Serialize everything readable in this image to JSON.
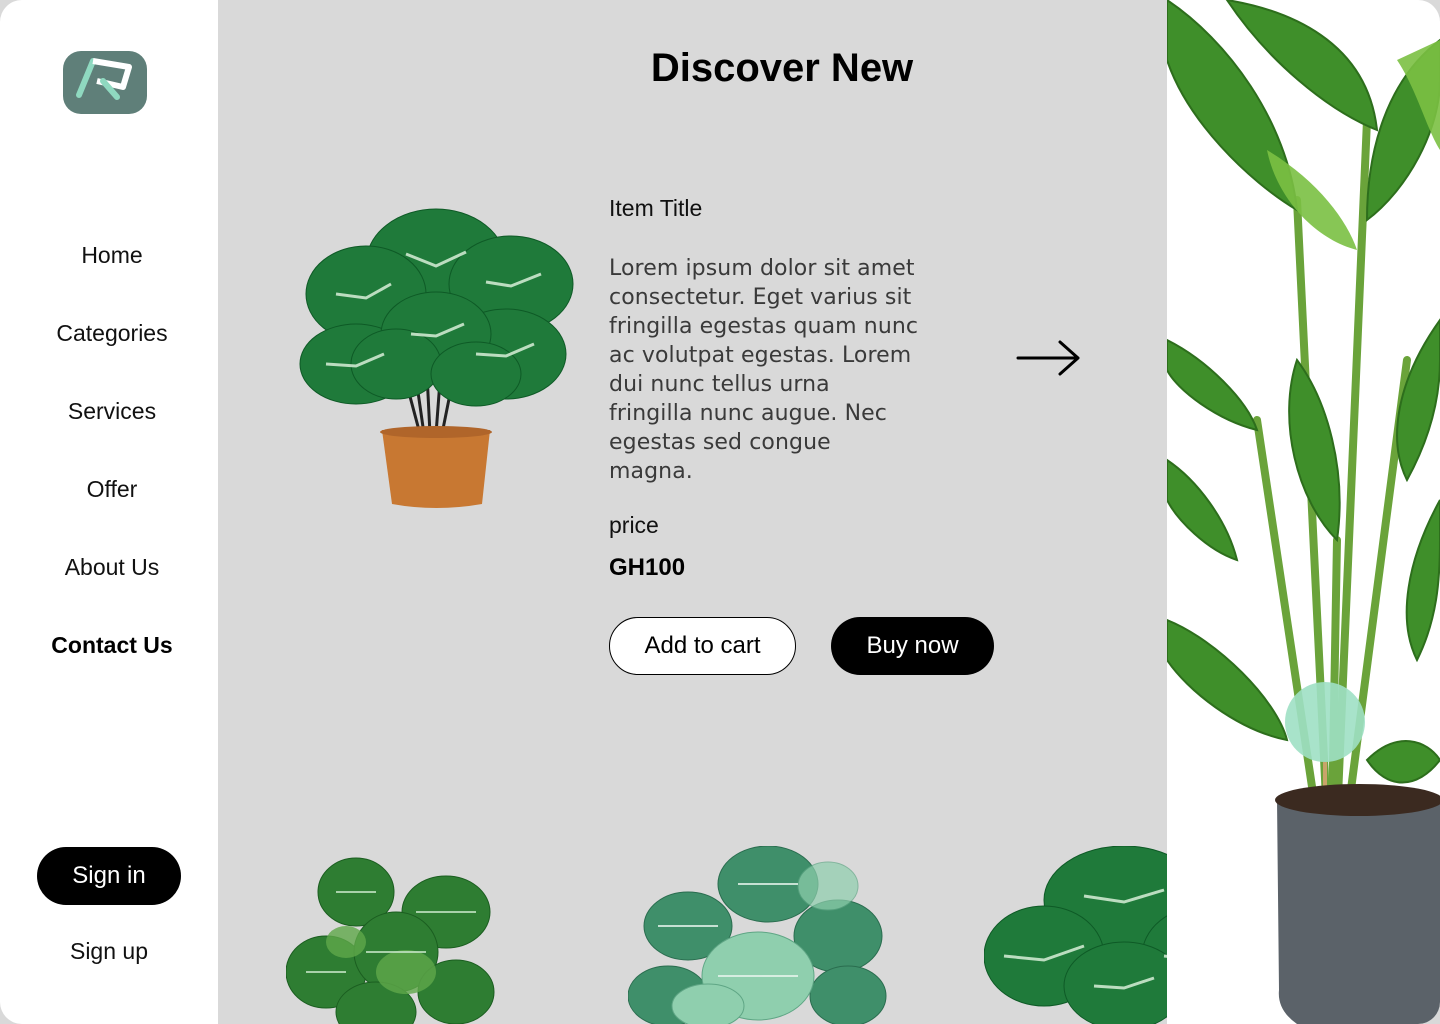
{
  "sidebar": {
    "nav": [
      {
        "label": "Home"
      },
      {
        "label": "Categories"
      },
      {
        "label": "Services"
      },
      {
        "label": "Offer"
      },
      {
        "label": "About Us"
      },
      {
        "label": "Contact Us",
        "active": true
      }
    ],
    "signin_label": "Sign in",
    "signup_label": "Sign up"
  },
  "main": {
    "title": "Discover New",
    "item": {
      "title": "Item Title",
      "description": "Lorem ipsum dolor sit amet consectetur. Eget varius sit fringilla egestas quam nunc ac volutpat egestas. Lorem dui nunc tellus urna fringilla nunc augue. Nec egestas sed congue magna.",
      "price_label": "price",
      "price_value": "GH100",
      "add_to_cart_label": "Add to cart",
      "buy_now_label": "Buy now"
    }
  },
  "colors": {
    "background": "#d9d9d9",
    "sidebar": "#ffffff",
    "logo": "#5f7f79",
    "accent_logo_stroke": "#8fd9c0",
    "leaf_dark": "#1f7a3a",
    "leaf_light": "#6fbf8e",
    "pot": "#c87832"
  },
  "icons": {
    "logo": "brand-logo-icon",
    "next": "arrow-right-icon"
  }
}
